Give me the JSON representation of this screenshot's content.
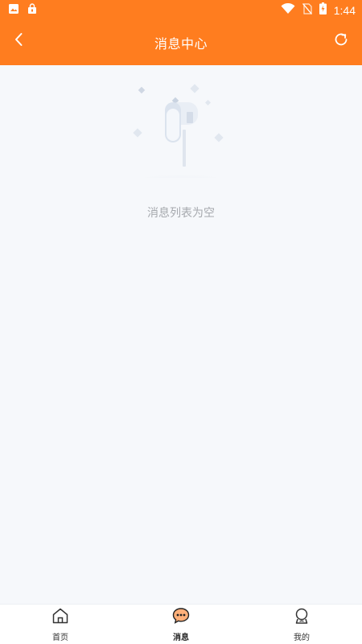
{
  "status_bar": {
    "time": "1:44",
    "icons": [
      "image-icon",
      "lock-app-icon",
      "wifi-icon",
      "no-sim-icon",
      "battery-charging-icon"
    ]
  },
  "app_bar": {
    "title": "消息中心",
    "back_icon": "chevron-left-icon",
    "refresh_icon": "refresh-icon"
  },
  "content": {
    "empty_text": "消息列表为空",
    "illustration": "empty-mailbox-illustration"
  },
  "tab_bar": {
    "tabs": [
      {
        "label": "首页",
        "icon": "home-icon",
        "active": false
      },
      {
        "label": "消息",
        "icon": "chat-bubble-icon",
        "active": true
      },
      {
        "label": "我的",
        "icon": "profile-icon",
        "active": false
      }
    ]
  },
  "colors": {
    "primary": "#ff7d1f",
    "background": "#f6f8fb",
    "empty_text": "#a6a9ae"
  }
}
